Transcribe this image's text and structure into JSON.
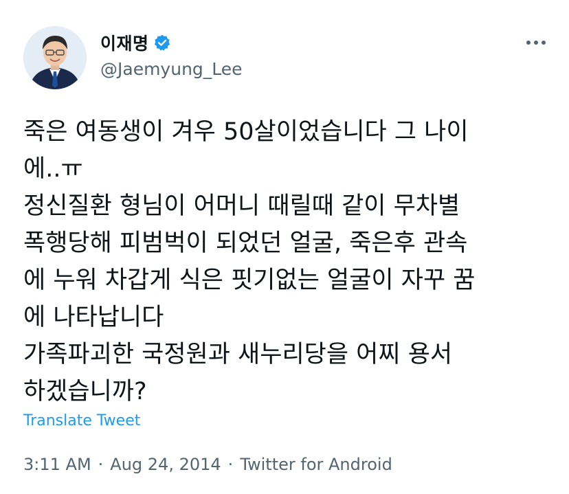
{
  "author": {
    "display_name": "이재명",
    "handle": "@Jaemyung_Lee",
    "verified": true
  },
  "icons": {
    "verified": "verified-badge-icon",
    "more": "more-options-icon",
    "avatar": "profile-photo"
  },
  "tweet": {
    "text": "죽은 여동생이 겨우 50살이었습니다 그 나이\n에..ㅠ\n정신질환 형님이 어머니 때릴때 같이 무차별\n폭행당해 피범벅이 되었던 얼굴, 죽은후 관속\n에 누워 차갑게 식은 핏기없는 얼굴이 자꾸 꿈\n에 나타납니다\n가족파괴한 국정원과 새누리당을 어찌 용서\n하겠습니까?",
    "translate_label": "Translate Tweet"
  },
  "meta": {
    "time": "3:11 AM",
    "separator": "·",
    "date": "Aug 24, 2014",
    "source": "Twitter for Android"
  },
  "colors": {
    "text": "#0f1419",
    "secondary": "#536471",
    "accent": "#1d9bf0"
  }
}
